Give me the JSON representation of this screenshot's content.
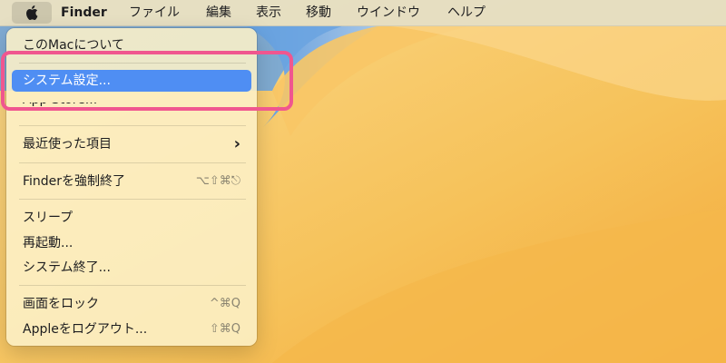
{
  "menubar": {
    "apple_icon": "apple-logo-icon",
    "app_name": "Finder",
    "items": [
      "ファイル",
      "編集",
      "表示",
      "移動",
      "ウインドウ",
      "ヘルプ"
    ]
  },
  "apple_menu": {
    "about": "このMacについて",
    "system_settings": "システム設定...",
    "app_store": "App Store...",
    "recent_items": "最近使った項目",
    "recent_items_chevron": "›",
    "force_quit": "Finderを強制終了",
    "force_quit_shortcut": "⌥⇧⌘⎋",
    "sleep": "スリープ",
    "restart": "再起動...",
    "shut_down": "システム終了...",
    "lock_screen": "画面をロック",
    "lock_screen_shortcut": "^⌘Q",
    "log_out": "Appleをログアウト...",
    "log_out_shortcut": "⇧⌘Q"
  },
  "colors": {
    "highlight": "#4f8ef3",
    "callout": "#f0568f",
    "wallpaper_orange": "#f6c25a",
    "wallpaper_blue": "#6aa3e0"
  }
}
